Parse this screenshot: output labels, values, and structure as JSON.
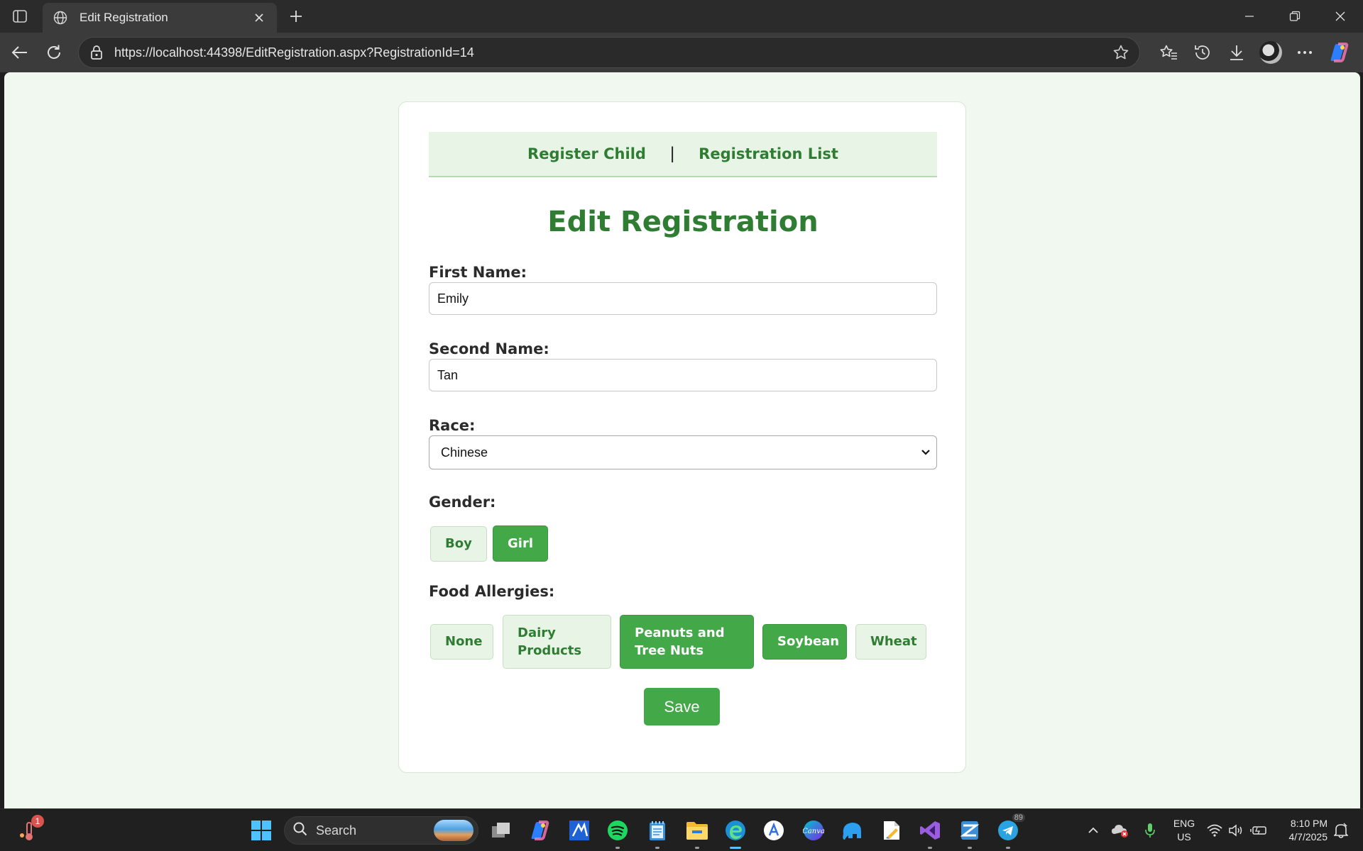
{
  "browser": {
    "tab_title": "Edit Registration",
    "url": "https://localhost:44398/EditRegistration.aspx?RegistrationId=14"
  },
  "nav": {
    "link1": "Register Child",
    "separator": "|",
    "link2": "Registration List"
  },
  "form": {
    "heading": "Edit Registration",
    "first_name_label": "First Name:",
    "first_name_value": "Emily",
    "second_name_label": "Second Name:",
    "second_name_value": "Tan",
    "race_label": "Race:",
    "race_selected": "Chinese",
    "gender_label": "Gender:",
    "gender_options": [
      {
        "label": "Boy",
        "selected": false
      },
      {
        "label": "Girl",
        "selected": true
      }
    ],
    "allergies_label": "Food Allergies:",
    "allergy_options": [
      {
        "label": "None",
        "selected": false
      },
      {
        "label": "Dairy Products",
        "selected": false
      },
      {
        "label": "Peanuts and Tree Nuts",
        "selected": true
      },
      {
        "label": "Soybean",
        "selected": true
      },
      {
        "label": "Wheat",
        "selected": false
      }
    ],
    "save_label": "Save"
  },
  "taskbar": {
    "search_label": "Search",
    "notification_count": "1",
    "telegram_badge": "89",
    "lang_line1": "ENG",
    "lang_line2": "US",
    "time": "8:10 PM",
    "date": "4/7/2025"
  },
  "colors": {
    "accent_green": "#43a847",
    "text_green": "#2e7d32",
    "page_bg": "#f1f8ef"
  }
}
